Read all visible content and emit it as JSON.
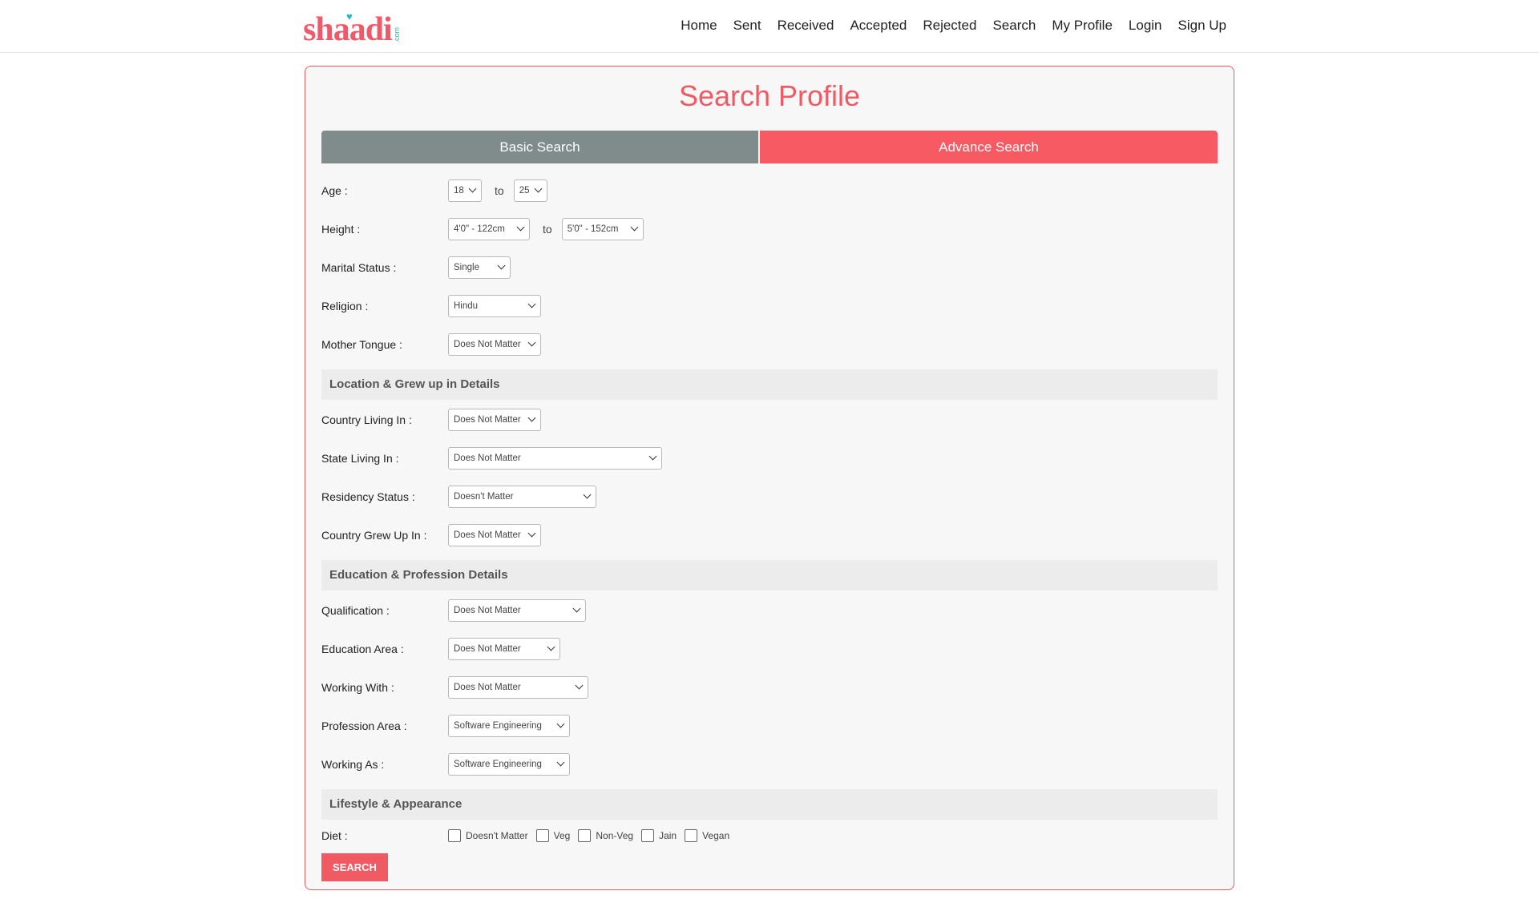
{
  "brand": {
    "name": "shaadi",
    "suffix": ".com"
  },
  "nav": [
    "Home",
    "Sent",
    "Received",
    "Accepted",
    "Rejected",
    "Search",
    "My Profile",
    "Login",
    "Sign Up"
  ],
  "page_title": "Search Profile",
  "tabs": {
    "basic": "Basic Search",
    "advance": "Advance Search"
  },
  "fields": {
    "age": {
      "label": "Age :",
      "from": "18",
      "to_label": "to",
      "to": "25"
    },
    "height": {
      "label": "Height :",
      "from": "4'0\" - 122cm",
      "to_label": "to",
      "to": "5'0\" - 152cm"
    },
    "marital_status": {
      "label": "Marital Status :",
      "value": "Single"
    },
    "religion": {
      "label": "Religion :",
      "value": "Hindu"
    },
    "mother_tongue": {
      "label": "Mother Tongue :",
      "value": "Does Not Matter"
    }
  },
  "sections": {
    "location": "Location & Grew up in Details",
    "education": "Education & Profession Details",
    "lifestyle": "Lifestyle & Appearance"
  },
  "location_fields": {
    "country_living": {
      "label": "Country Living In :",
      "value": "Does Not Matter"
    },
    "state_living": {
      "label": "State Living In :",
      "value": "Does Not Matter"
    },
    "residency": {
      "label": "Residency Status :",
      "value": "Doesn't Matter"
    },
    "country_grew": {
      "label": "Country Grew Up In :",
      "value": "Does Not Matter"
    }
  },
  "education_fields": {
    "qualification": {
      "label": "Qualification :",
      "value": "Does Not Matter"
    },
    "education_area": {
      "label": "Education Area :",
      "value": "Does Not Matter"
    },
    "working_with": {
      "label": "Working With :",
      "value": "Does Not Matter"
    },
    "profession_area": {
      "label": "Profession Area :",
      "value": "Software Engineering"
    },
    "working_as": {
      "label": "Working As :",
      "value": "Software Engineering"
    }
  },
  "diet": {
    "label": "Diet :",
    "options": [
      "Doesn't Matter",
      "Veg",
      "Non-Veg",
      "Jain",
      "Vegan"
    ]
  },
  "search_button": "SEARCH",
  "colors": {
    "accent": "#f05a63",
    "tab_inactive": "#808b8c"
  }
}
